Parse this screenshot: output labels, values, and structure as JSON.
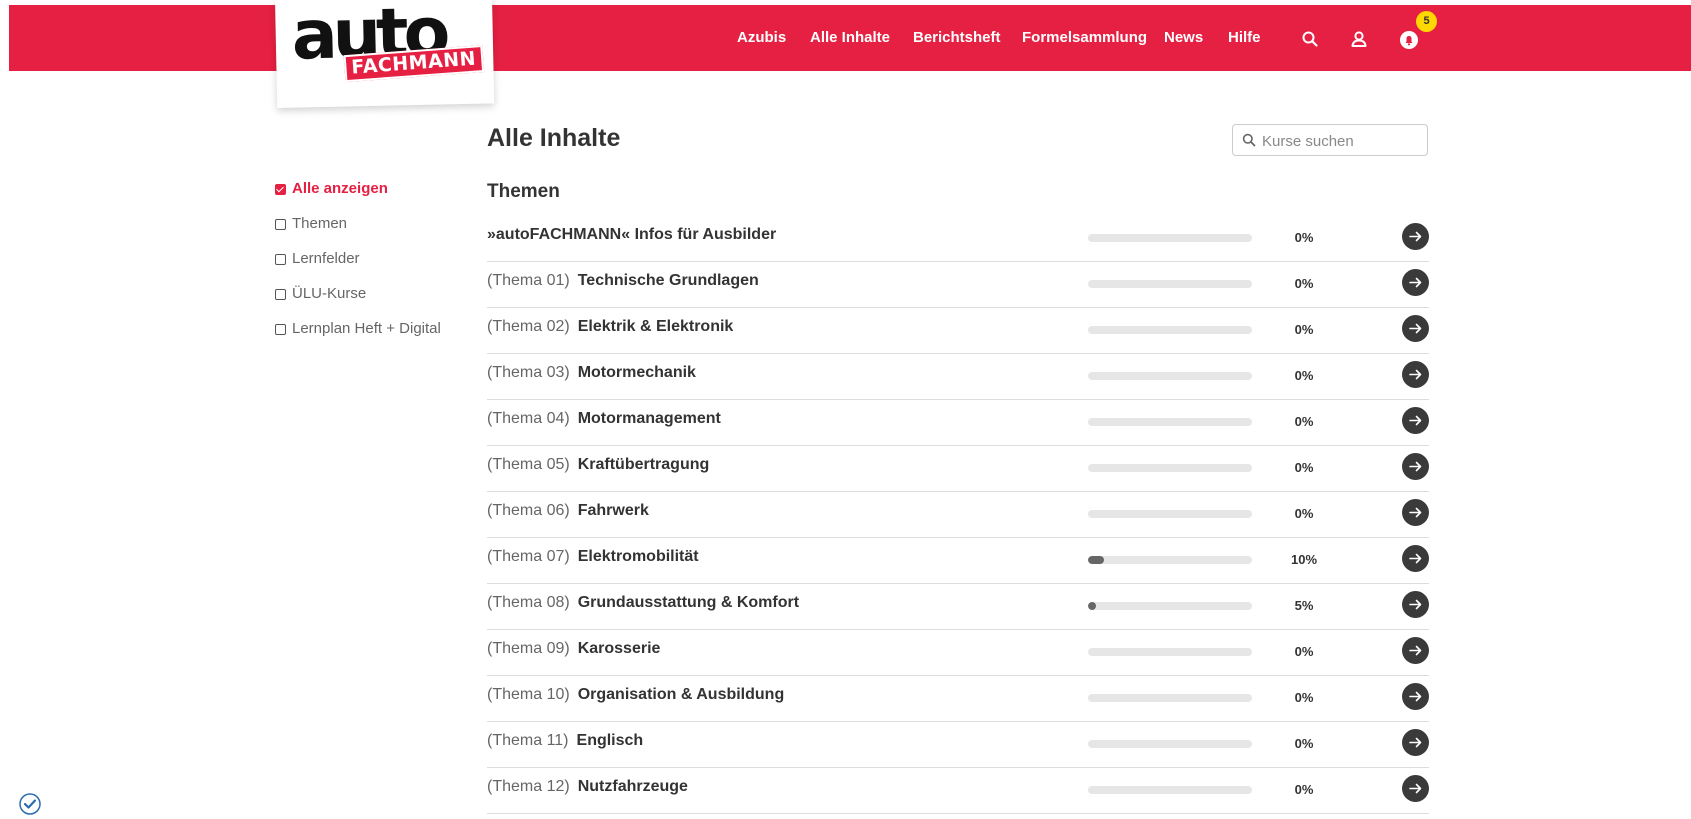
{
  "header": {
    "logo": {
      "word": "auto",
      "sub": "FACHMANN"
    },
    "nav": [
      "Azubis",
      "Alle Inhalte",
      "Berichtsheft",
      "Formelsammlung",
      "News",
      "Hilfe"
    ],
    "icons": [
      "search-icon",
      "user-icon",
      "notification-bell-icon"
    ],
    "notification_count": "5",
    "brand_color": "#e62042",
    "badge_color": "#ffd800"
  },
  "page": {
    "title": "Alle Inhalte"
  },
  "search": {
    "placeholder": "Kurse suchen",
    "value": ""
  },
  "filters": [
    {
      "label": "Alle anzeigen",
      "checked": true
    },
    {
      "label": "Themen",
      "checked": false
    },
    {
      "label": "Lernfelder",
      "checked": false
    },
    {
      "label": "ÜLU-Kurse",
      "checked": false
    },
    {
      "label": "Lernplan Heft + Digital",
      "checked": false
    }
  ],
  "section": {
    "title": "Themen"
  },
  "courses": [
    {
      "num": "",
      "name": "»autoFACHMANN« Infos für Ausbilder",
      "progress": 0,
      "pct": "0%"
    },
    {
      "num": "(Thema 01)",
      "name": "Technische Grundlagen",
      "progress": 0,
      "pct": "0%"
    },
    {
      "num": "(Thema 02)",
      "name": "Elektrik & Elektronik",
      "progress": 0,
      "pct": "0%"
    },
    {
      "num": "(Thema 03)",
      "name": "Motormechanik",
      "progress": 0,
      "pct": "0%"
    },
    {
      "num": "(Thema 04)",
      "name": "Motormanagement",
      "progress": 0,
      "pct": "0%"
    },
    {
      "num": "(Thema 05)",
      "name": "Kraftübertragung",
      "progress": 0,
      "pct": "0%"
    },
    {
      "num": "(Thema 06)",
      "name": "Fahrwerk",
      "progress": 0,
      "pct": "0%"
    },
    {
      "num": "(Thema 07)",
      "name": "Elektromobilität",
      "progress": 10,
      "pct": "10%"
    },
    {
      "num": "(Thema 08)",
      "name": "Grundausstattung & Komfort",
      "progress": 5,
      "pct": "5%"
    },
    {
      "num": "(Thema 09)",
      "name": "Karosserie",
      "progress": 0,
      "pct": "0%"
    },
    {
      "num": "(Thema 10)",
      "name": "Organisation & Ausbildung",
      "progress": 0,
      "pct": "0%"
    },
    {
      "num": "(Thema 11)",
      "name": "Englisch",
      "progress": 0,
      "pct": "0%"
    },
    {
      "num": "(Thema 12)",
      "name": "Nutzfahrzeuge",
      "progress": 0,
      "pct": "0%"
    }
  ]
}
